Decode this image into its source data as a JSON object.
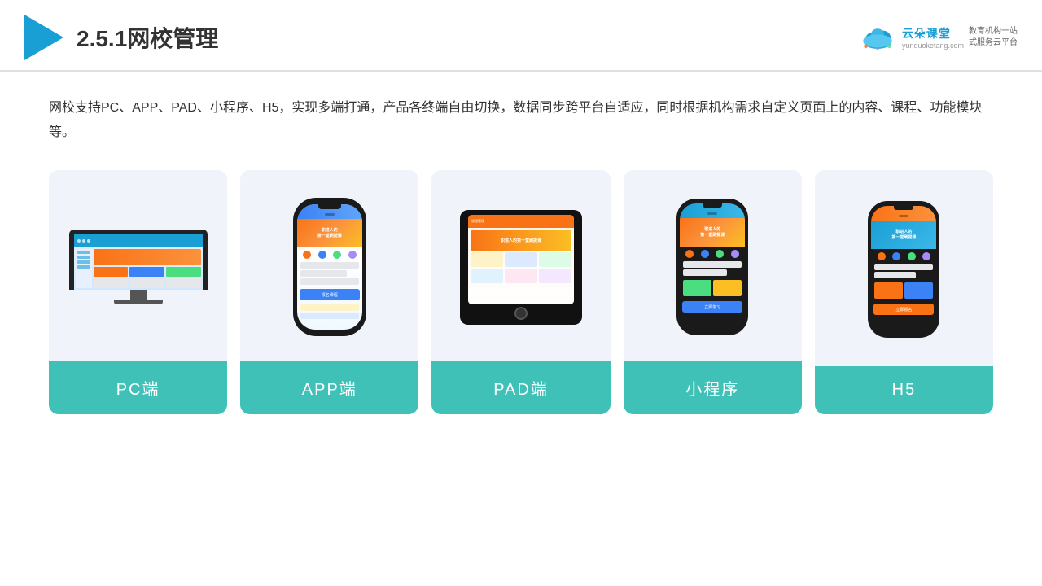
{
  "header": {
    "title": "2.5.1网校管理",
    "logo": {
      "main": "云朵课堂",
      "url": "yunduoketang.com",
      "tagline1": "教育机构一站",
      "tagline2": "式服务云平台"
    }
  },
  "content": {
    "description": "网校支持PC、APP、PAD、小程序、H5，实现多端打通，产品各终端自由切换，数据同步跨平台自适应，同时根据机构需求自定义页面上的内容、课程、功能模块等。"
  },
  "cards": [
    {
      "id": "pc",
      "label": "PC端"
    },
    {
      "id": "app",
      "label": "APP端"
    },
    {
      "id": "pad",
      "label": "PAD端"
    },
    {
      "id": "miniapp",
      "label": "小程序"
    },
    {
      "id": "h5",
      "label": "H5"
    }
  ],
  "colors": {
    "teal": "#3fc1b8",
    "blue": "#1a9fd4",
    "accent": "#f97316"
  }
}
